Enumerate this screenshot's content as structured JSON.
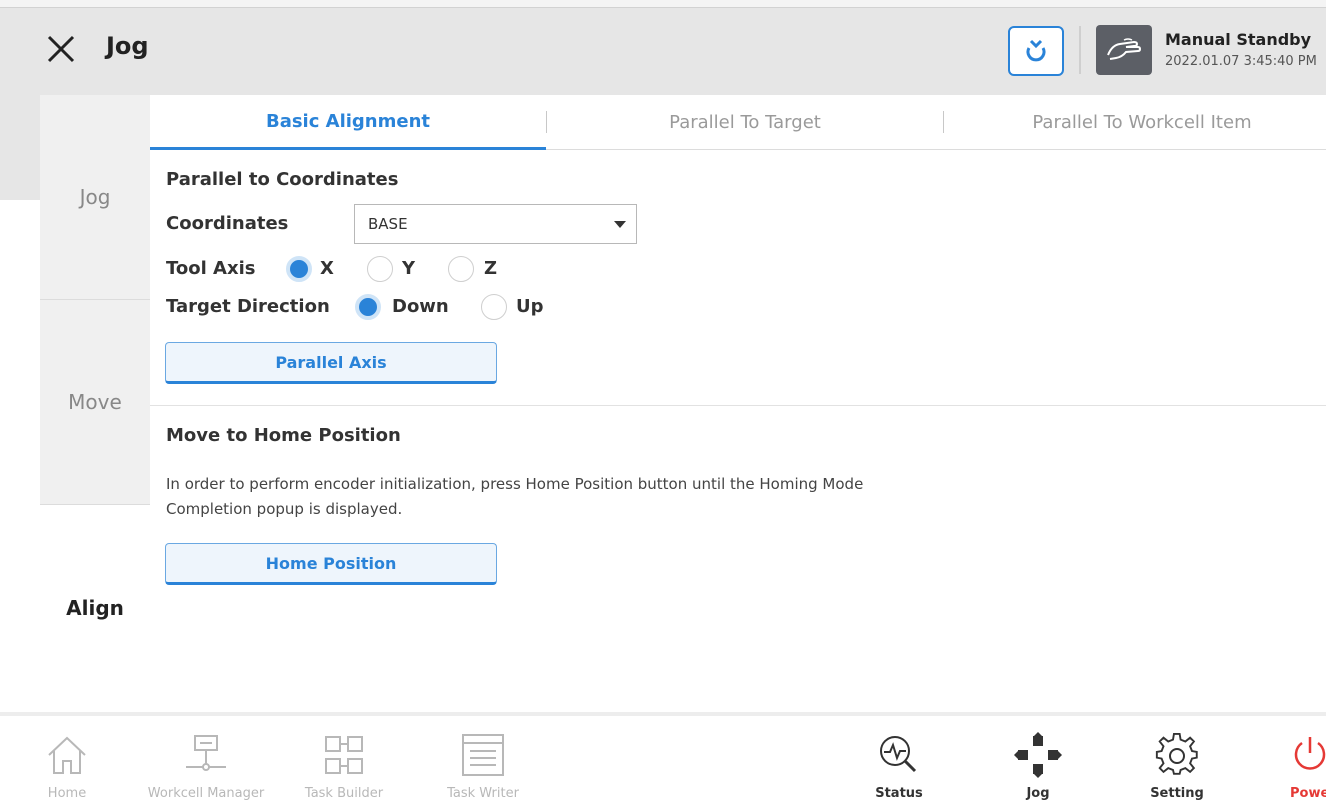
{
  "header": {
    "title": "Jog",
    "status_title": "Manual Standby",
    "status_time": "2022.01.07 3:45:40 PM",
    "close_icon": "close-icon",
    "sync_icon": "refresh-arrow-icon",
    "mode_icon": "hand-icon",
    "accent_color": "#2a83d8"
  },
  "sidebar": {
    "items": [
      {
        "label": "Jog",
        "active": false
      },
      {
        "label": "Move",
        "active": false
      },
      {
        "label": "Align",
        "active": true
      }
    ]
  },
  "tabs": [
    {
      "label": "Basic Alignment",
      "active": true
    },
    {
      "label": "Parallel To Target",
      "active": false
    },
    {
      "label": "Parallel To Workcell Item",
      "active": false
    }
  ],
  "parallel": {
    "title": "Parallel to Coordinates",
    "coordinates_label": "Coordinates",
    "coordinates_value": "BASE",
    "tool_axis_label": "Tool Axis",
    "tool_axis_options": [
      "X",
      "Y",
      "Z"
    ],
    "tool_axis_selected": "X",
    "target_direction_label": "Target Direction",
    "target_direction_options": [
      "Down",
      "Up"
    ],
    "target_direction_selected": "Down",
    "button_label": "Parallel Axis"
  },
  "home": {
    "title": "Move to Home Position",
    "description": "In order to perform encoder initialization, press Home Position button until the Homing Mode Completion popup is displayed.",
    "button_label": "Home Position"
  },
  "bottom_nav": {
    "items": [
      {
        "label": "Home",
        "icon": "home-icon",
        "enabled": false
      },
      {
        "label": "Workcell Manager",
        "icon": "workcell-icon",
        "enabled": false
      },
      {
        "label": "Task Builder",
        "icon": "task-builder-icon",
        "enabled": false
      },
      {
        "label": "Task Writer",
        "icon": "task-writer-icon",
        "enabled": false
      },
      {
        "label": "Status",
        "icon": "status-icon",
        "enabled": true
      },
      {
        "label": "Jog",
        "icon": "jog-icon",
        "enabled": true
      },
      {
        "label": "Setting",
        "icon": "gear-icon",
        "enabled": true
      },
      {
        "label": "Power",
        "icon": "power-icon",
        "enabled": true
      }
    ]
  }
}
